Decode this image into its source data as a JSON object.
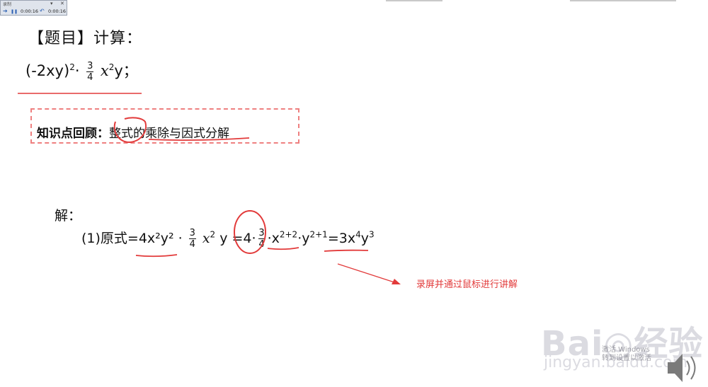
{
  "recorder": {
    "title": "录制",
    "minimize": "▾",
    "close": "✕",
    "elapsed": "0:00:16",
    "total": "0:00:16",
    "play_glyph": "➔",
    "pause_glyph": "❚❚",
    "rewind_glyph": "↶"
  },
  "problem": {
    "title": "【题目】计算：",
    "expr_base": "(-2xy)",
    "expr_exp": "2",
    "expr_dot": "·",
    "frac_num": "3",
    "frac_den": "4",
    "expr_var": "x",
    "expr_var_exp": "2",
    "expr_tail": "y；"
  },
  "review": {
    "label": "知识点回顾：",
    "topic": "整式的乘除与因式分解"
  },
  "solution": {
    "label": "解：",
    "step_prefix": "(1)原式=4x²y² · ",
    "frac_num": "3",
    "frac_den": "4",
    "part_x": "x",
    "part_x_exp": "2",
    "part_y": "y =4·",
    "frac2_num": "3",
    "frac2_den": "4",
    "part_x2": "·x",
    "exp_x": "2+2",
    "part_y2": "·y",
    "exp_y": "2+1",
    "part_res": "=3x",
    "res_x_exp": "4",
    "res_y": "y",
    "res_y_exp": "3"
  },
  "annotation_text": "录屏并通过鼠标进行讲解",
  "watermark": {
    "logo": "Bai◎经验",
    "url": "jingyan.baidu.com"
  },
  "windows_notice": {
    "line1": "激活 Windows",
    "line2": "转到设置以激活"
  },
  "colors": {
    "annotation_red": "#e23a3a",
    "box_dash": "#ee8080"
  }
}
